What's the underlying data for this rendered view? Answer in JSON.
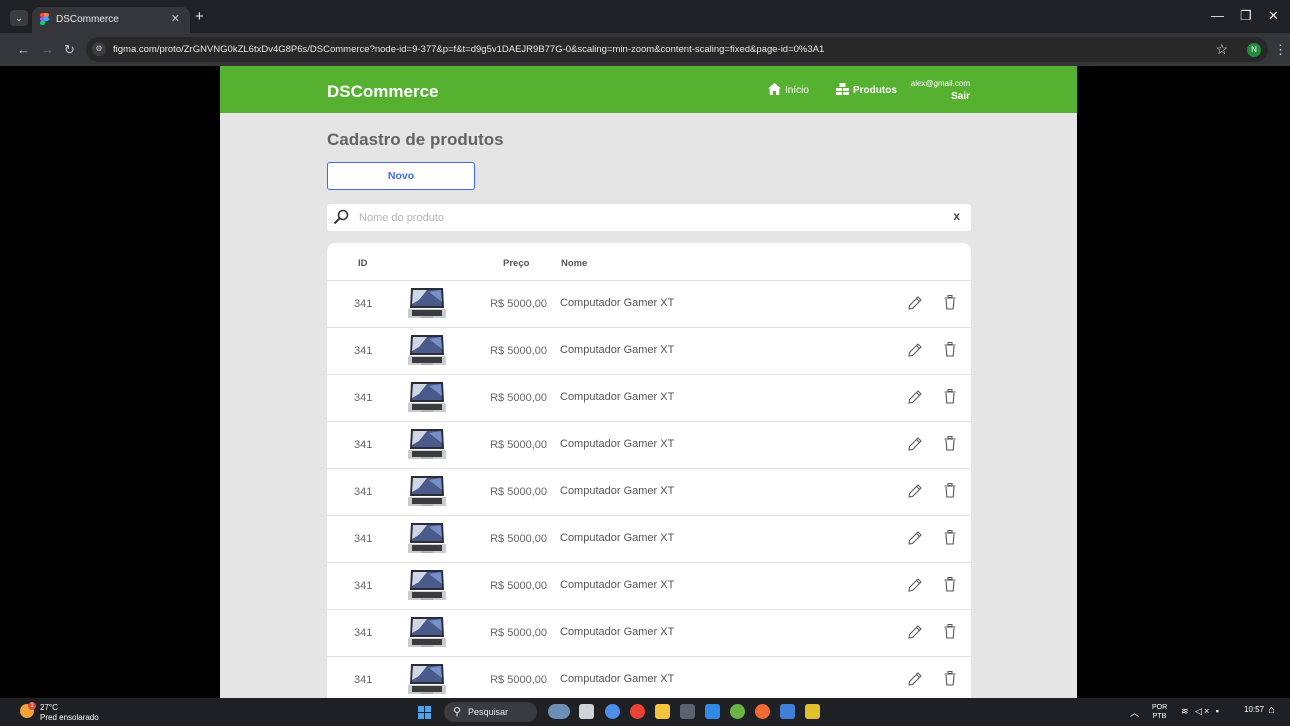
{
  "browser": {
    "tab_title": "DSCommerce",
    "url": "figma.com/proto/ZrGNVNG0kZL6txDv4G8P6s/DSCommerce?node-id=9-377&p=f&t=d9g5v1DAEJR9B77G-0&scaling=min-zoom&content-scaling=fixed&page-id=0%3A1",
    "profile_initial": "N"
  },
  "header": {
    "logo": "DSCommerce",
    "nav_home": "Início",
    "nav_products": "Produtos",
    "user_email": "alex@gmail.com",
    "logout": "Sair"
  },
  "page": {
    "title": "Cadastro de produtos",
    "new_button": "Novo",
    "search_placeholder": "Nome do produto",
    "clear_symbol": "x"
  },
  "table": {
    "columns": {
      "id": "ID",
      "price": "Preço",
      "name": "Nome"
    },
    "rows": [
      {
        "id": "341",
        "price": "R$ 5000,00",
        "name": "Computador Gamer XT"
      },
      {
        "id": "341",
        "price": "R$ 5000,00",
        "name": "Computador Gamer XT"
      },
      {
        "id": "341",
        "price": "R$ 5000,00",
        "name": "Computador Gamer XT"
      },
      {
        "id": "341",
        "price": "R$ 5000,00",
        "name": "Computador Gamer XT"
      },
      {
        "id": "341",
        "price": "R$ 5000,00",
        "name": "Computador Gamer XT"
      },
      {
        "id": "341",
        "price": "R$ 5000,00",
        "name": "Computador Gamer XT"
      },
      {
        "id": "341",
        "price": "R$ 5000,00",
        "name": "Computador Gamer XT"
      },
      {
        "id": "341",
        "price": "R$ 5000,00",
        "name": "Computador Gamer XT"
      },
      {
        "id": "341",
        "price": "R$ 5000,00",
        "name": "Computador Gamer XT"
      }
    ]
  },
  "taskbar": {
    "temperature": "27°C",
    "weather": "Pred ensolarado",
    "weather_badge": "1",
    "search_label": "Pesquisar",
    "language_top": "POR",
    "language_bottom": "PTB",
    "time": "10:57"
  },
  "colors": {
    "header_green": "#56b130",
    "accent_blue": "#3f6be6",
    "page_background": "#e5e5e5"
  },
  "icons": [
    "home-icon",
    "products-icon",
    "search-icon",
    "edit-icon",
    "trash-icon"
  ]
}
